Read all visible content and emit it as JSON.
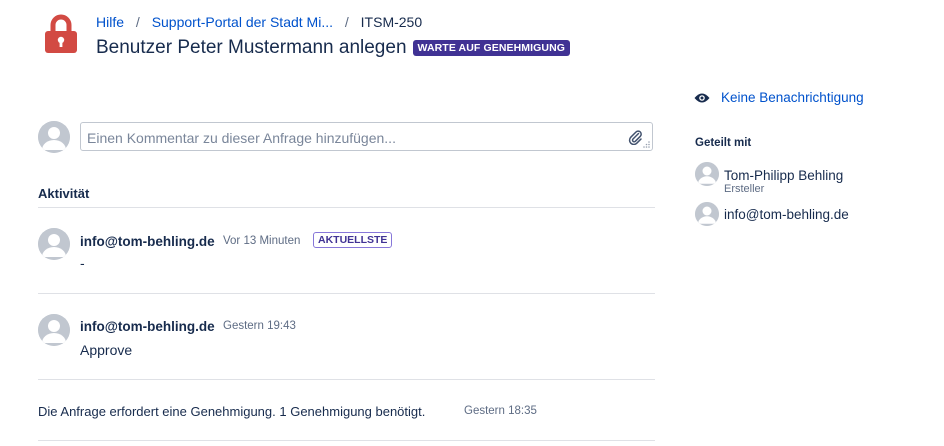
{
  "breadcrumb": {
    "items": [
      "Hilfe",
      "Support-Portal der Stadt Mi...",
      "ITSM-250"
    ],
    "separator": "/"
  },
  "request": {
    "title": "Benutzer Peter Mustermann anlegen",
    "status": "WARTE AUF GENEHMIGUNG"
  },
  "comment_input": {
    "placeholder": "Einen Kommentar zu dieser Anfrage hinzufügen..."
  },
  "activity": {
    "heading": "Aktivität",
    "comments": [
      {
        "author": "info@tom-behling.de",
        "time": "Vor 13 Minuten",
        "badge": "AKTUELLSTE",
        "body": "-"
      },
      {
        "author": "info@tom-behling.de",
        "time": "Gestern 19:43",
        "badge": "",
        "body": "Approve"
      }
    ],
    "approval_event": {
      "text": "Die Anfrage erfordert eine Genehmigung. 1 Genehmigung benötigt.",
      "time": "Gestern 18:35"
    }
  },
  "sidebar": {
    "notification_label": "Keine Benachrichtigung",
    "shared_heading": "Geteilt mit",
    "participants": [
      {
        "name": "Tom-Philipp Behling",
        "role": "Ersteller"
      },
      {
        "name": "info@tom-behling.de",
        "role": ""
      }
    ]
  },
  "colors": {
    "accent": "#0052cc",
    "status_lozenge": "#403294",
    "lock_icon": "#de350b",
    "divider": "#dfe1e6"
  },
  "icons": [
    "lock-icon",
    "paperclip-icon",
    "eye-icon",
    "avatar-icon"
  ]
}
